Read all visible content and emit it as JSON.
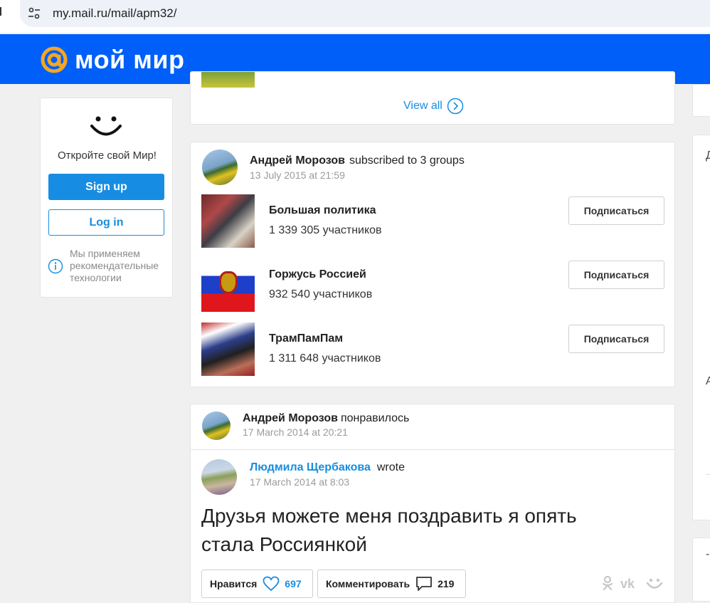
{
  "browser": {
    "url": "my.mail.ru/mail/apm32/"
  },
  "header": {
    "brand": "мой мир",
    "brand_color": "#005ff9",
    "logo_color": "#f5a623"
  },
  "sidebar": {
    "open_text": "Откройте свой Мир!",
    "signup_label": "Sign up",
    "login_label": "Log in",
    "tech_text": "Мы применяем рекомендательные технологии"
  },
  "top_card": {
    "view_all_label": "View all"
  },
  "subscriptions": {
    "author": "Андрей Морозов",
    "action": "subscribed to 3 groups",
    "date": "13 July 2015 at 21:59",
    "groups": [
      {
        "name": "Большая политика",
        "members": "1 339 305 участников",
        "button": "Подписаться"
      },
      {
        "name": "Горжусь Россией",
        "members": "932 540 участников",
        "button": "Подписаться"
      },
      {
        "name": "ТрамПамПам",
        "members": "1 311 648 участников",
        "button": "Подписаться"
      }
    ]
  },
  "liked_post": {
    "liker": "Андрей Морозов",
    "liker_action": "понравилось",
    "liker_date": "17 March 2014 at 20:21",
    "author": "Людмила Щербакова",
    "author_action": "wrote",
    "author_date": "17 March 2014 at 8:03",
    "text": "Друзья можете меня поздравить я опять стала Россиянкой",
    "like_label": "Нравится",
    "like_count": "697",
    "comment_label": "Комментировать",
    "comment_count": "219"
  },
  "right_column": {
    "char_1": "Д",
    "char_2": "А",
    "char_3": "-"
  }
}
